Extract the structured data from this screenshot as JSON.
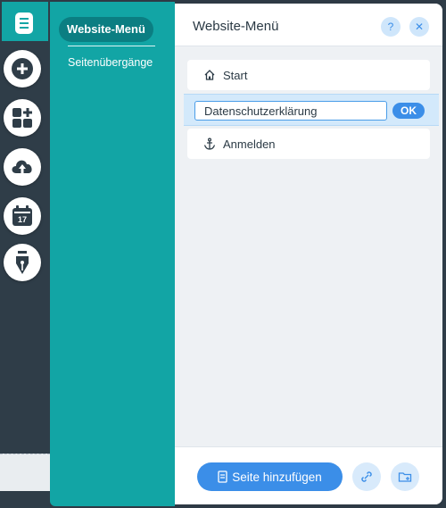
{
  "rail": {
    "items": [
      {
        "icon": "pages-icon"
      },
      {
        "icon": "add-icon"
      },
      {
        "icon": "app-market-icon"
      },
      {
        "icon": "upload-icon"
      },
      {
        "icon": "calendar-icon"
      },
      {
        "icon": "pen-icon"
      }
    ],
    "calendar_day": "17"
  },
  "submenu": {
    "active": "Website-Menü",
    "second": "Seitenübergänge"
  },
  "panel": {
    "title": "Website-Menü",
    "help_symbol": "?",
    "close_symbol": "✕",
    "pages": [
      {
        "label": "Start",
        "icon": "home-icon"
      },
      {
        "label": "Datenschutzerklärung",
        "editing": true
      },
      {
        "label": "Anmelden",
        "icon": "anchor-icon"
      }
    ],
    "ok_label": "OK",
    "add_page_label": "Seite hinzufügen"
  },
  "colors": {
    "teal": "#12a5a5",
    "teal_dark": "#0b7e82",
    "accent_blue": "#3b8ee8",
    "rail": "#2f3d48"
  }
}
